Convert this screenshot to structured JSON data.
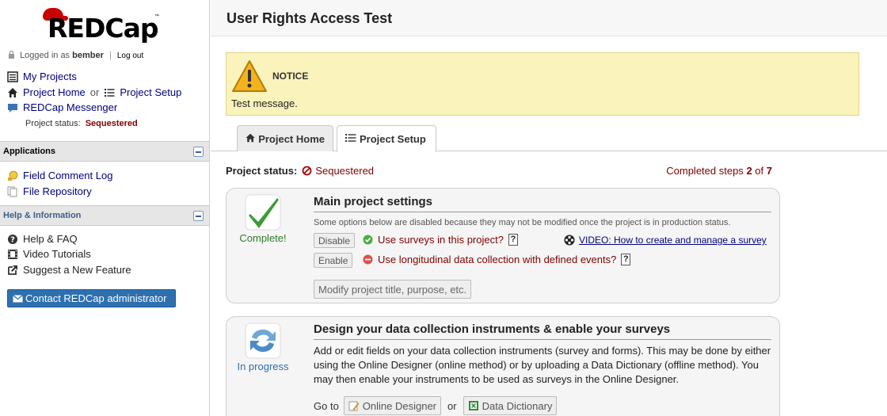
{
  "sidebar": {
    "logo_text": "REDCap",
    "logo_tm": "™",
    "login_prefix": "Logged in as",
    "username": "bember",
    "separator": "|",
    "logout": "Log out",
    "my_projects": "My Projects",
    "project_home": "Project Home",
    "or": "or",
    "project_setup": "Project Setup",
    "messenger": "REDCap Messenger",
    "status_label": "Project status:",
    "status_value": "Sequestered",
    "applications_header": "Applications",
    "applications": [
      {
        "label": "Field Comment Log",
        "icon": "comment-bubble-icon"
      },
      {
        "label": "File Repository",
        "icon": "documents-icon"
      }
    ],
    "help_header": "Help & Information",
    "help_items": [
      {
        "label": "Help & FAQ",
        "icon": "question-circle-icon"
      },
      {
        "label": "Video Tutorials",
        "icon": "film-icon"
      },
      {
        "label": "Suggest a New Feature",
        "icon": "external-link-icon"
      }
    ],
    "contact_button": "Contact REDCap administrator"
  },
  "header": {
    "title": "User Rights Access Test"
  },
  "notice": {
    "title": "NOTICE",
    "message": "Test message."
  },
  "tabs": [
    {
      "label": "Project Home",
      "icon": "home-icon",
      "active": false
    },
    {
      "label": "Project Setup",
      "icon": "list-icon",
      "active": true
    }
  ],
  "status": {
    "label": "Project status:",
    "value": "Sequestered",
    "steps_prefix": "Completed steps",
    "steps_done": "2",
    "steps_of": "of",
    "steps_total": "7"
  },
  "card1": {
    "side_label": "Complete!",
    "title": "Main project settings",
    "note": "Some options below are disabled because they may not be modified once the project is in production status.",
    "disable_button": "Disable",
    "enable_button": "Enable",
    "option1": "Use surveys in this project?",
    "option2": "Use longitudinal data collection with defined events?",
    "help_mark": "?",
    "video_link": "VIDEO: How to create and manage a survey",
    "modify_button": "Modify project title, purpose, etc."
  },
  "card2": {
    "side_label": "In progress",
    "title": "Design your data collection instruments & enable your surveys",
    "description": "Add or edit fields on your data collection instruments (survey and forms). This may be done by either using the Online Designer (online method) or by uploading a Data Dictionary (offline method). You may then enable your instruments to be used as surveys in the Online Designer.",
    "goto_label": "Go to",
    "online_designer": "Online Designer",
    "or": "or",
    "data_dictionary": "Data Dictionary"
  },
  "colors": {
    "accent_red": "#800000",
    "notice_bg": "#fbf3bc",
    "button_blue": "#2e6fae",
    "link_navy": "#000080"
  }
}
